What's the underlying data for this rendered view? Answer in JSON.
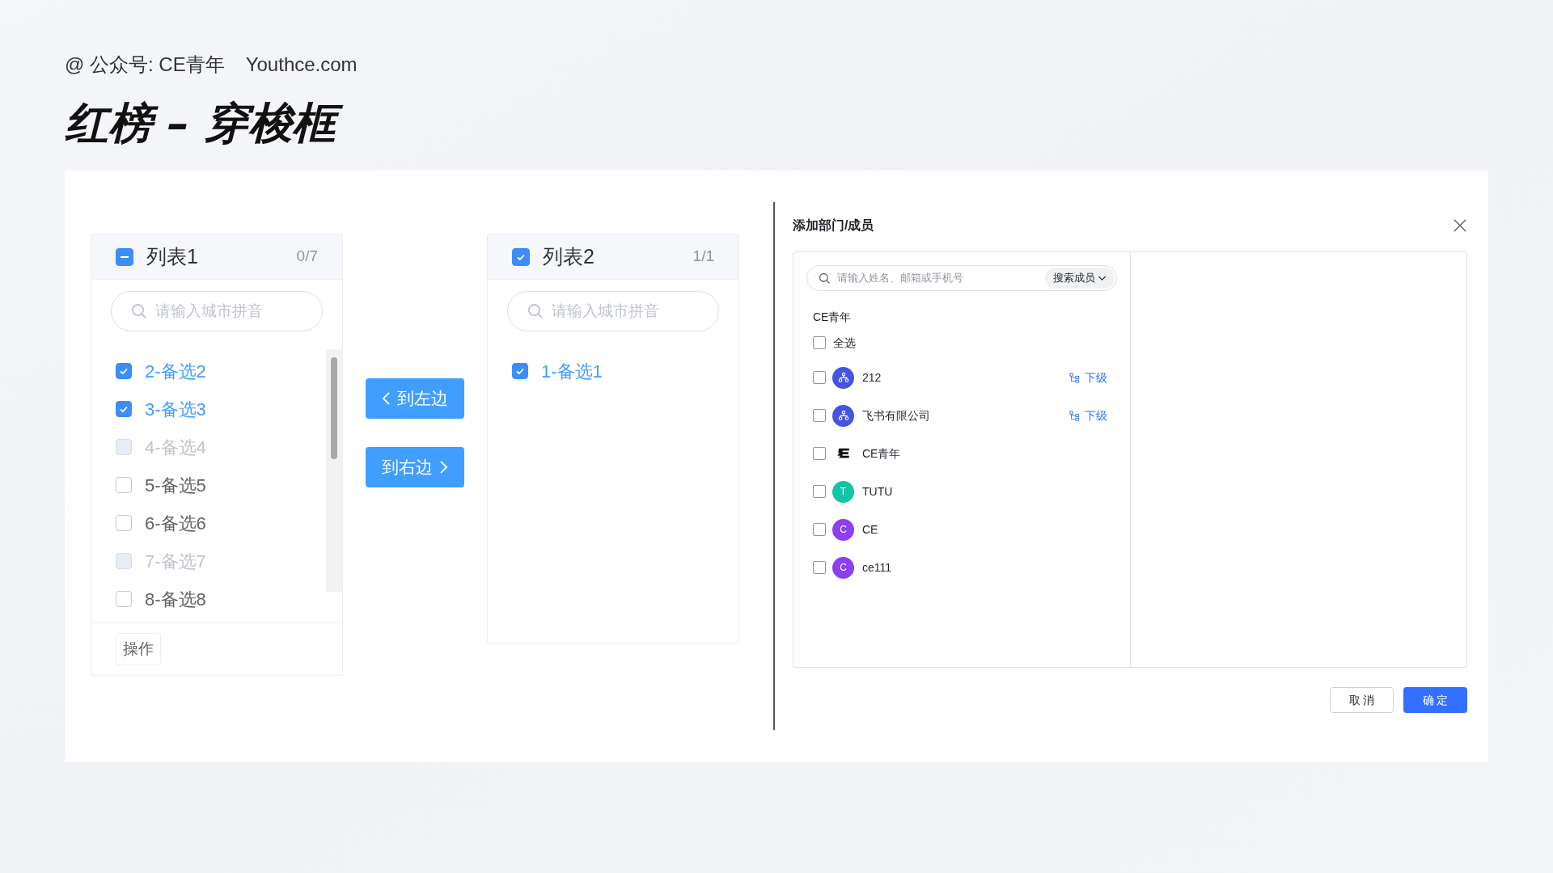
{
  "credit": "@ 公众号: CE青年",
  "site": "Youthce.com",
  "title": "红榜 – 穿梭框",
  "lists": [
    {
      "title": "列表1",
      "count": "0/7",
      "all_checked": false,
      "partial": true,
      "placeholder": "请输入城市拼音",
      "scrollbar": true,
      "footer_button": "操作",
      "items": [
        {
          "label": "2-备选2",
          "checked": true,
          "disabled": false
        },
        {
          "label": "3-备选3",
          "checked": true,
          "disabled": false
        },
        {
          "label": "4-备选4",
          "checked": false,
          "disabled": true
        },
        {
          "label": "5-备选5",
          "checked": false,
          "disabled": false
        },
        {
          "label": "6-备选6",
          "checked": false,
          "disabled": false
        },
        {
          "label": "7-备选7",
          "checked": false,
          "disabled": true
        },
        {
          "label": "8-备选8",
          "checked": false,
          "disabled": false
        }
      ]
    },
    {
      "title": "列表2",
      "count": "1/1",
      "all_checked": true,
      "partial": false,
      "placeholder": "请输入城市拼音",
      "items": [
        {
          "label": "1-备选1",
          "checked": true,
          "disabled": false
        }
      ]
    }
  ],
  "move_buttons": [
    {
      "label": "到左边",
      "kind": "left"
    },
    {
      "label": "到右边",
      "kind": "right"
    }
  ],
  "dialog": {
    "title": "添加部门/成员",
    "search_placeholder": "请输入姓名、邮箱或手机号",
    "search_scope": "搜索成员",
    "group": "CE青年",
    "select_all": {
      "label": "全选",
      "checked": false
    },
    "members": [
      {
        "name": "212",
        "kind": "department",
        "checked": false,
        "sub_link": "下级"
      },
      {
        "name": "飞书有限公司",
        "kind": "department",
        "checked": false,
        "sub_link": "下级"
      },
      {
        "name": "CE青年",
        "kind": "logo",
        "checked": false
      },
      {
        "name": "TUTU",
        "kind": "person",
        "initial": "T",
        "color": "#14c4a4",
        "checked": false
      },
      {
        "name": "CE",
        "kind": "person",
        "initial": "C",
        "color": "#8b3ff0",
        "checked": false
      },
      {
        "name": "ce111",
        "kind": "person",
        "initial": "C",
        "color": "#8b3ff0",
        "checked": false
      }
    ],
    "buttons": [
      {
        "label": "取 消",
        "kind": "secondary"
      },
      {
        "label": "确 定",
        "kind": "primary"
      }
    ]
  }
}
